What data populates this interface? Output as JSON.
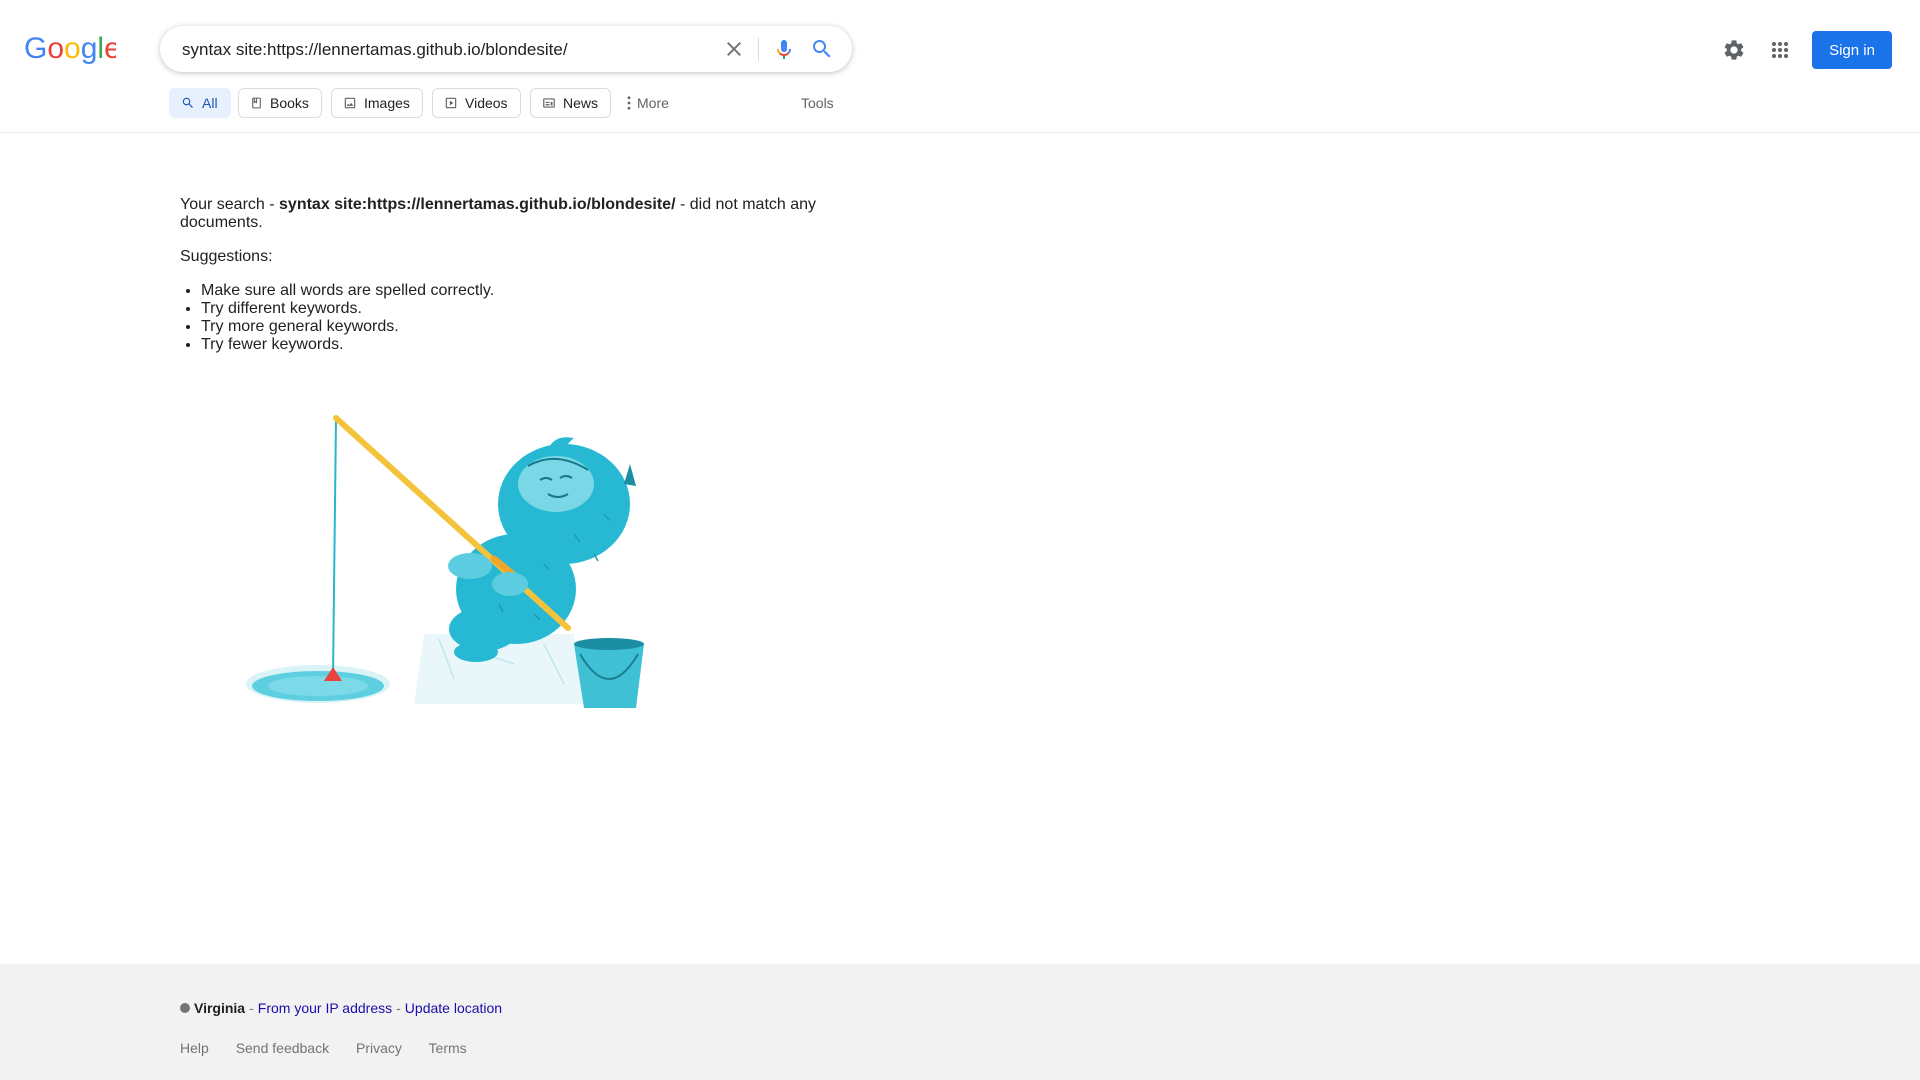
{
  "header": {
    "logo_text": "Google",
    "search": {
      "value": "syntax site:https://lennertamas.github.io/blondesite/",
      "clear_icon": "close-icon",
      "mic_icon": "microphone-icon",
      "search_icon": "search-icon"
    },
    "settings_icon": "gear-icon",
    "apps_icon": "apps-grid-icon",
    "sign_in_label": "Sign in",
    "colors": {
      "brand_blue": "#1a73e8",
      "active_tab_bg": "#e8f0fe"
    }
  },
  "tabs": {
    "items": [
      {
        "label": "All",
        "icon": "search-icon",
        "active": true
      },
      {
        "label": "Books",
        "icon": "book-icon",
        "active": false
      },
      {
        "label": "Images",
        "icon": "image-icon",
        "active": false
      },
      {
        "label": "Videos",
        "icon": "video-icon",
        "active": false
      },
      {
        "label": "News",
        "icon": "news-icon",
        "active": false
      }
    ],
    "more_label": "More",
    "tools_label": "Tools"
  },
  "results": {
    "no_match_prefix": "Your search - ",
    "query": "syntax site:https://lennertamas.github.io/blondesite/",
    "no_match_suffix": " - did not match any documents.",
    "suggestions_heading": "Suggestions:",
    "suggestions": [
      "Make sure all words are spelled correctly.",
      "Try different keywords.",
      "Try more general keywords.",
      "Try fewer keywords."
    ],
    "illustration": "fishing-yeti-illustration"
  },
  "footer": {
    "location": "Virginia",
    "separator": "-",
    "from_ip": "From your IP address",
    "update_location": "Update location",
    "links": [
      "Help",
      "Send feedback",
      "Privacy",
      "Terms"
    ]
  }
}
